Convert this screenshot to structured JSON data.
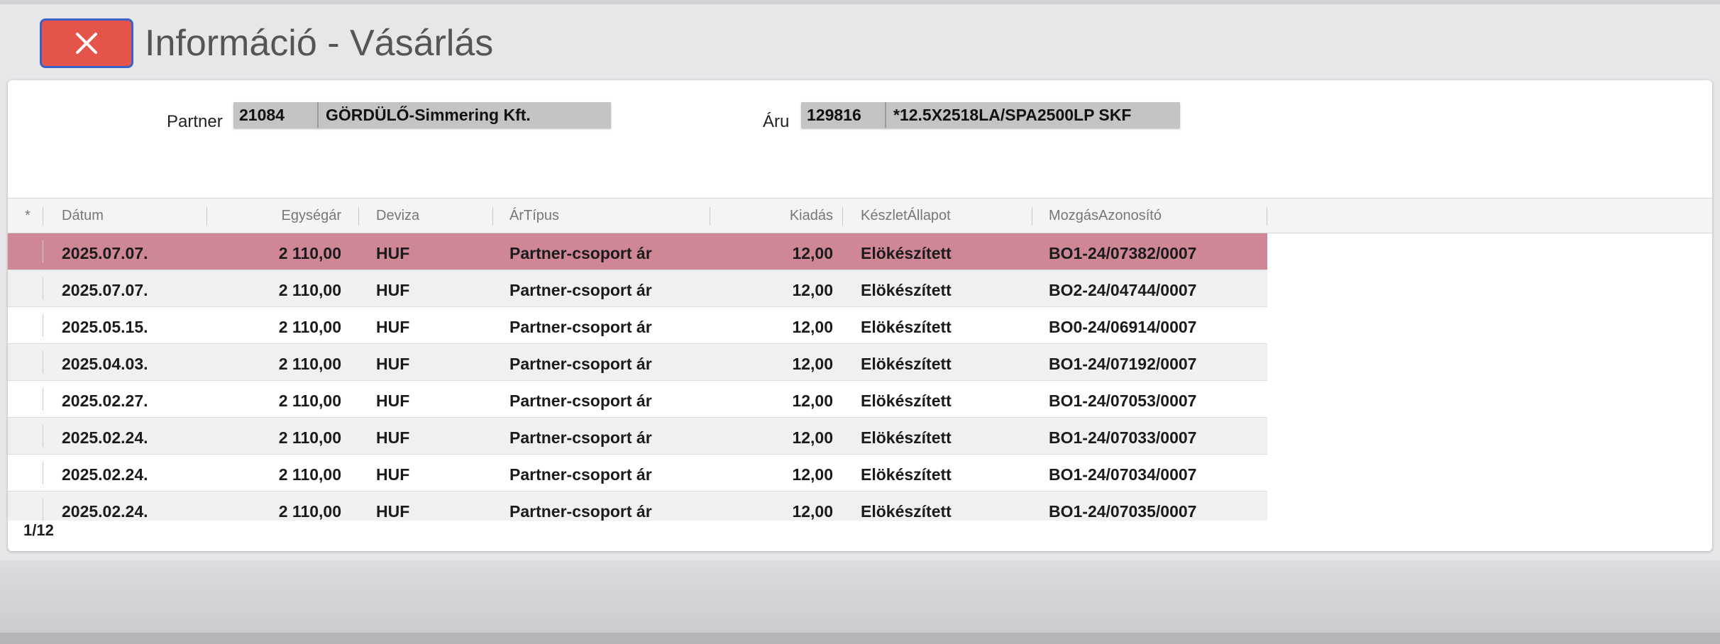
{
  "window": {
    "title": "Információ - Vásárlás"
  },
  "filters": {
    "partner": {
      "label": "Partner",
      "code": "21084",
      "name": "GÖRDÜLŐ-Simmering Kft."
    },
    "aru": {
      "label": "Áru",
      "code": "129816",
      "name": "*12.5X2518LA/SPA2500LP SKF"
    }
  },
  "table": {
    "headers": {
      "marker": "*",
      "datum": "Dátum",
      "egysegar": "Egységár",
      "deviza": "Deviza",
      "artipus": "ÁrTípus",
      "kiadas": "Kiadás",
      "keszlet": "KészletÁllapot",
      "mozgas": "MozgásAzonosító"
    },
    "rows": [
      {
        "datum": "2025.07.07.",
        "egysegar": "2 110,00",
        "deviza": "HUF",
        "artipus": "Partner-csoport ár",
        "kiadas": "12,00",
        "keszlet": "Elökészített",
        "mozgas": "BO1-24/07382/0007",
        "selected": true
      },
      {
        "datum": "2025.07.07.",
        "egysegar": "2 110,00",
        "deviza": "HUF",
        "artipus": "Partner-csoport ár",
        "kiadas": "12,00",
        "keszlet": "Elökészített",
        "mozgas": "BO2-24/04744/0007"
      },
      {
        "datum": "2025.05.15.",
        "egysegar": "2 110,00",
        "deviza": "HUF",
        "artipus": "Partner-csoport ár",
        "kiadas": "12,00",
        "keszlet": "Elökészített",
        "mozgas": "BO0-24/06914/0007"
      },
      {
        "datum": "2025.04.03.",
        "egysegar": "2 110,00",
        "deviza": "HUF",
        "artipus": "Partner-csoport ár",
        "kiadas": "12,00",
        "keszlet": "Elökészített",
        "mozgas": "BO1-24/07192/0007"
      },
      {
        "datum": "2025.02.27.",
        "egysegar": "2 110,00",
        "deviza": "HUF",
        "artipus": "Partner-csoport ár",
        "kiadas": "12,00",
        "keszlet": "Elökészített",
        "mozgas": "BO1-24/07053/0007"
      },
      {
        "datum": "2025.02.24.",
        "egysegar": "2 110,00",
        "deviza": "HUF",
        "artipus": "Partner-csoport ár",
        "kiadas": "12,00",
        "keszlet": "Elökészített",
        "mozgas": "BO1-24/07033/0007"
      },
      {
        "datum": "2025.02.24.",
        "egysegar": "2 110,00",
        "deviza": "HUF",
        "artipus": "Partner-csoport ár",
        "kiadas": "12,00",
        "keszlet": "Elökészített",
        "mozgas": "BO1-24/07034/0007"
      },
      {
        "datum": "2025.02.24.",
        "egysegar": "2 110,00",
        "deviza": "HUF",
        "artipus": "Partner-csoport ár",
        "kiadas": "12,00",
        "keszlet": "Elökészített",
        "mozgas": "BO1-24/07035/0007"
      }
    ]
  },
  "pager": {
    "text": "1/12"
  },
  "colors": {
    "close_button": "#e4544a",
    "close_border": "#3a63c8",
    "selected_row": "#cf8796",
    "alt_row": "#f0f0f0",
    "row": "#ffffff"
  },
  "icons": {
    "close": "close-icon"
  }
}
